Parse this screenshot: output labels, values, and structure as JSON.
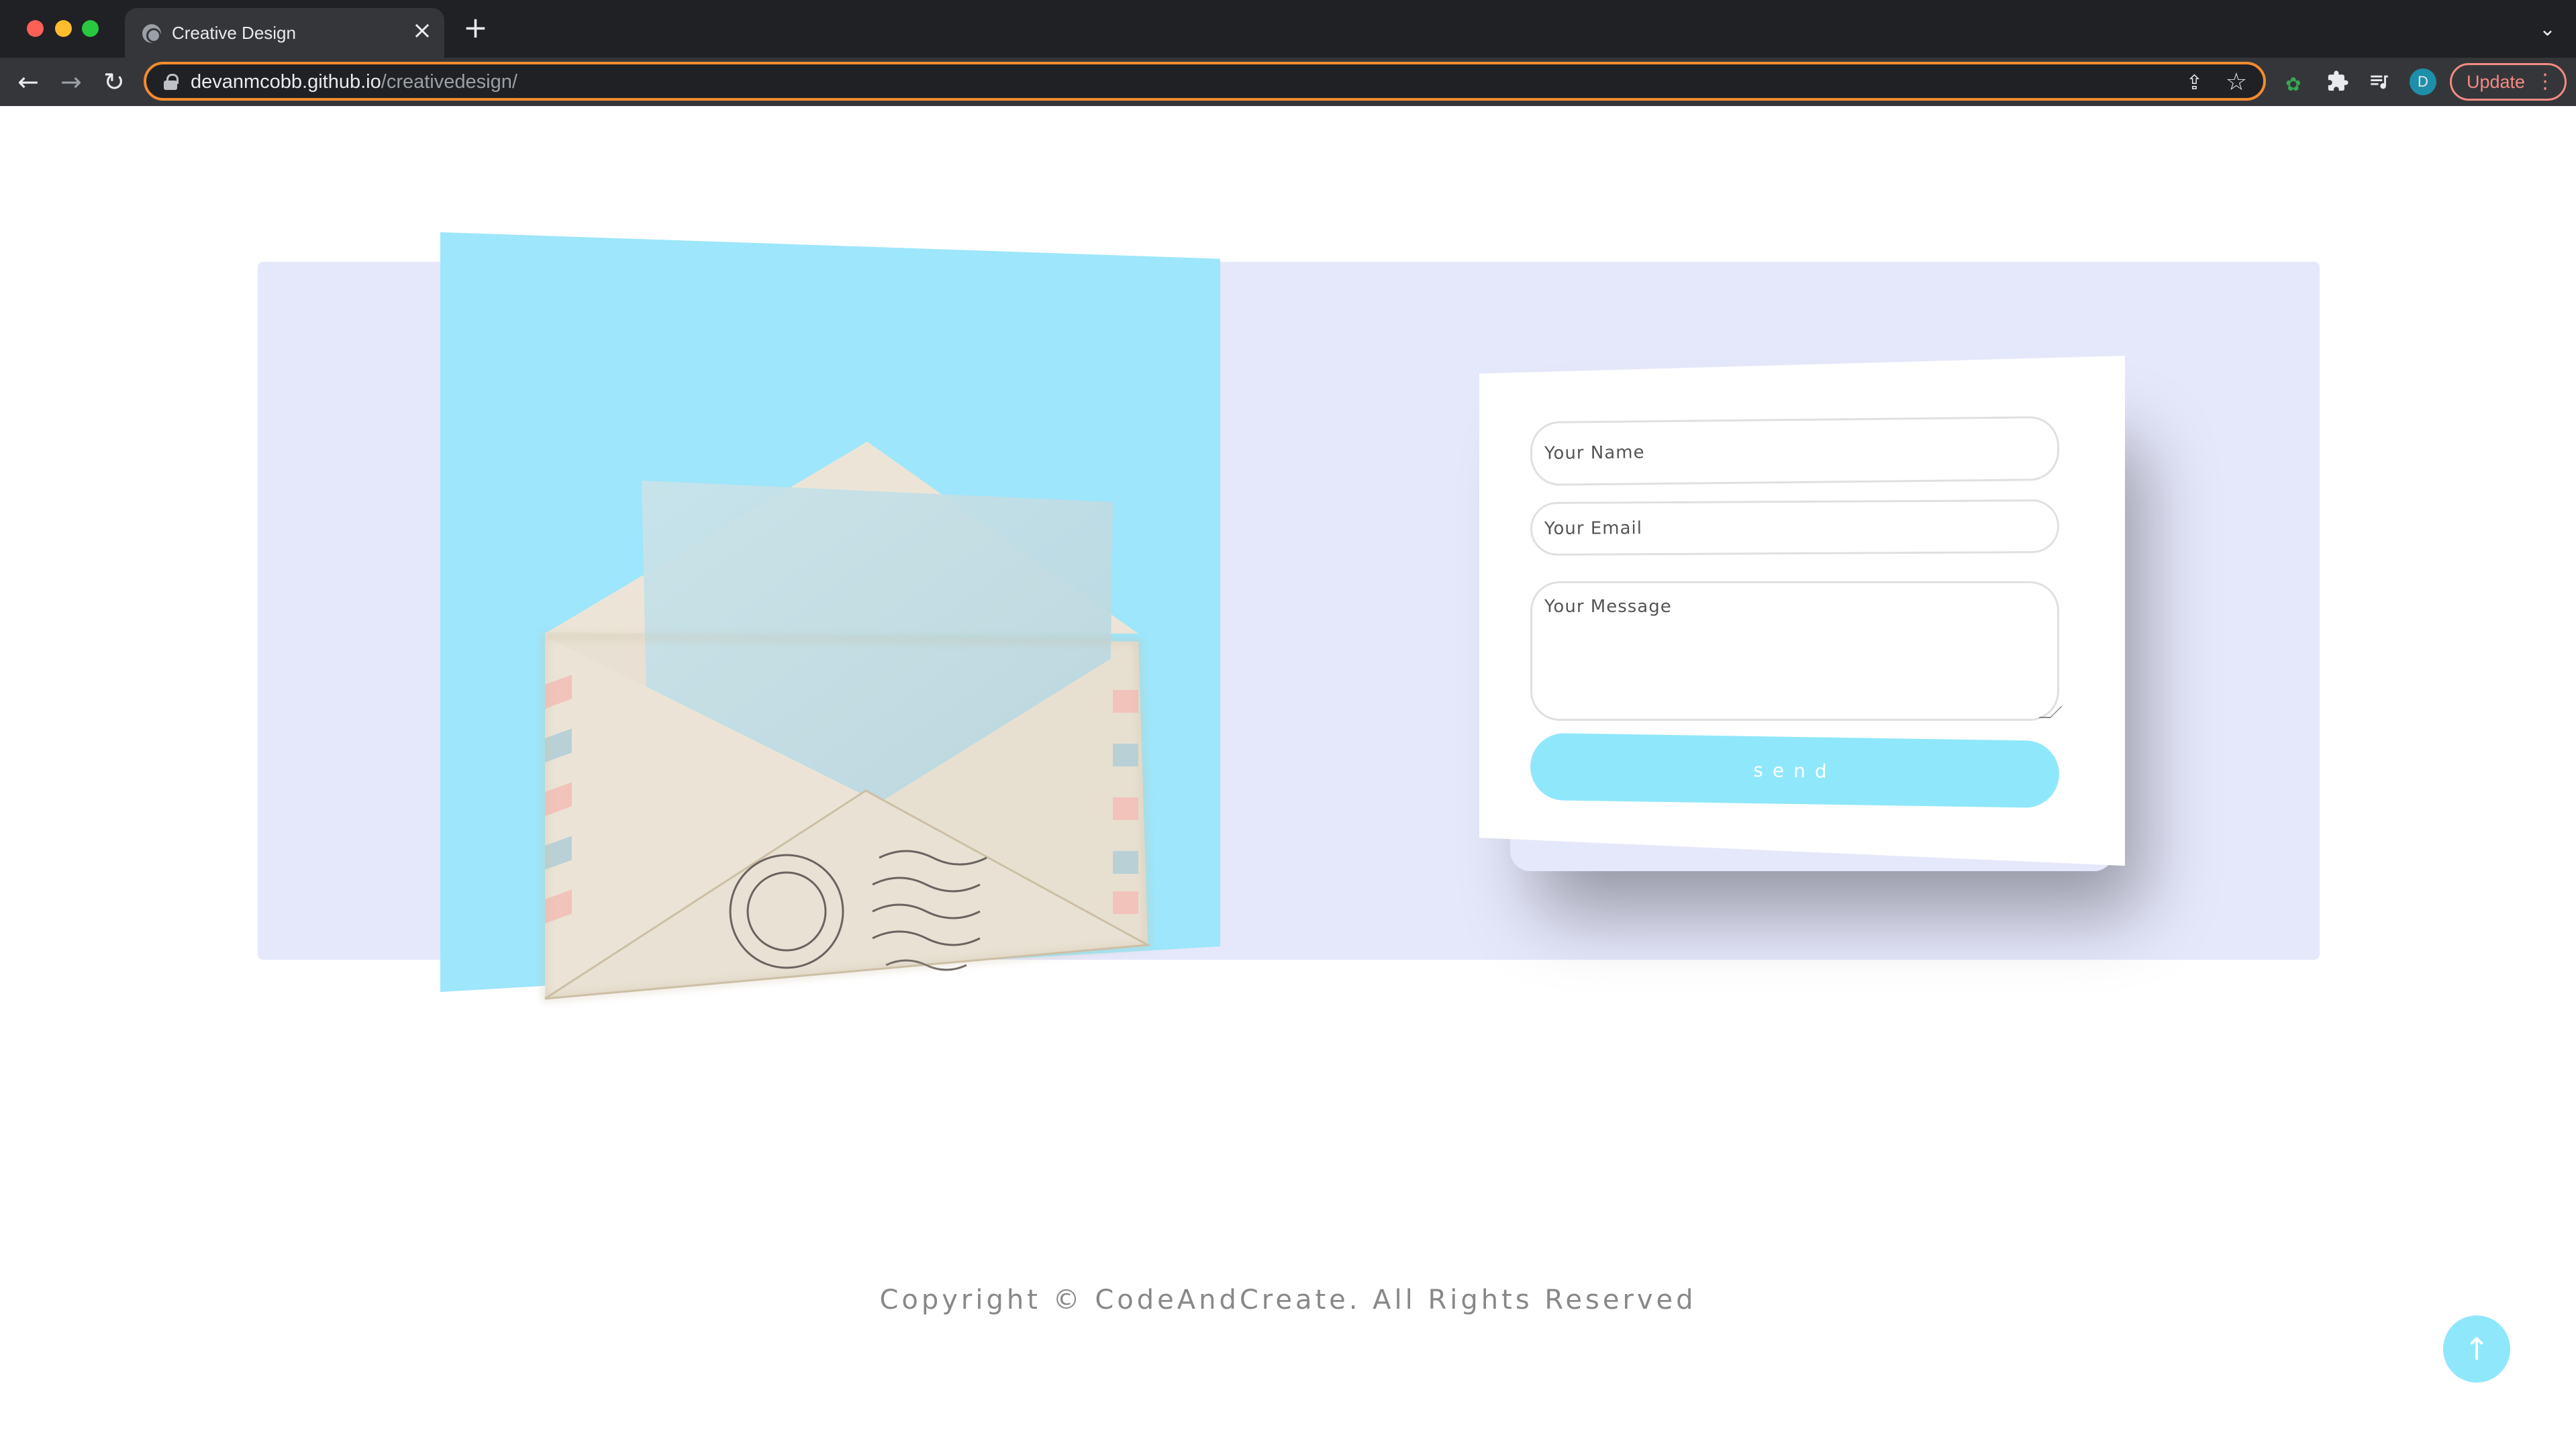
{
  "browser": {
    "tab_title": "Creative Design",
    "tab_close": "×",
    "new_tab": "+",
    "tab_menu": "⌄",
    "nav_back": "←",
    "nav_forward": "→",
    "nav_reload": "↻",
    "url_host": "devanmcobb.github.io",
    "url_path": "/creativedesign/",
    "share_icon": "⇪",
    "star_icon": "☆",
    "puzzle_icon": "✚",
    "media_icon": "≡",
    "paw_icon": "✿",
    "avatar_initial": "D",
    "update_label": "Update",
    "update_dots": "⋮",
    "accent_focus_color": "#f28b2e"
  },
  "page": {
    "band_color": "#e5e7fb",
    "panel_color": "#9de6fb",
    "contact_form": {
      "name_placeholder": "Your Name",
      "email_placeholder": "Your Email",
      "message_placeholder": "Your Message",
      "send_label": "send",
      "button_color": "#8fe7fb"
    },
    "footer": {
      "copyright": "Copyright © CodeAndCreate. All Rights Reserved"
    },
    "back_to_top_icon": "↑"
  }
}
